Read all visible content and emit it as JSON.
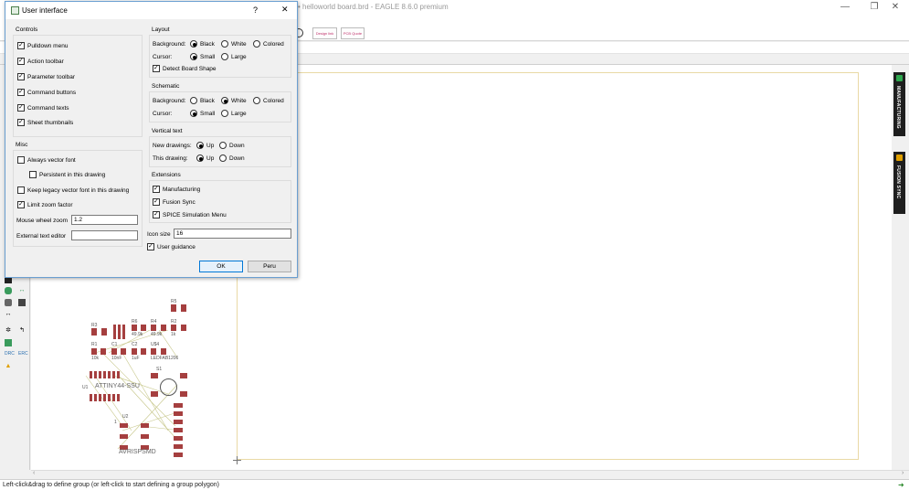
{
  "app": {
    "title": "• helloworld board.brd - EAGLE 8.6.0 premium",
    "min_glyph": "—",
    "max_glyph": "❐",
    "close_glyph": "✕"
  },
  "toolbar": {
    "btn1": "Design link",
    "btn2": "PCB Quote"
  },
  "canvas": {
    "parts": {
      "r1": "R1",
      "r1v": "10k",
      "c1": "C1",
      "c1v": "10nF",
      "c2": "C2",
      "c2v": "1uF",
      "r6": "R6",
      "r6v": "49.9k",
      "r4": "R4",
      "r4v": "49.9k",
      "r2": "R2",
      "r2v": "1k",
      "r3": "R3",
      "u1": "U1",
      "u1v": "ATTINY44-SSU",
      "led": "U$4",
      "ledv": "LEDFAB1206",
      "r5": "R5",
      "s1": "S1",
      "u2": "U2",
      "u2v": "AVRISPSMD",
      "pin1": "1"
    }
  },
  "right_panel": {
    "tab1": "MANUFACTURING",
    "tab2": "FUSION SYNC"
  },
  "status": {
    "text": "Left-click&drag to define group (or left-click to start defining a group polygon)",
    "icon": "➜"
  },
  "dialog": {
    "title": "User interface",
    "help": "?",
    "close": "✕",
    "controls": {
      "title": "Controls",
      "items": [
        "Pulldown menu",
        "Action toolbar",
        "Parameter toolbar",
        "Command buttons",
        "Command texts",
        "Sheet thumbnails"
      ]
    },
    "misc": {
      "title": "Misc",
      "always_vector": "Always vector font",
      "persistent": "Persistent in this drawing",
      "keep_legacy": "Keep legacy vector font in this drawing",
      "limit_zoom": "Limit zoom factor",
      "mouse_wheel_label": "Mouse wheel zoom",
      "mouse_wheel_value": "1.2",
      "ext_editor_label": "External text editor",
      "ext_editor_value": ""
    },
    "layout": {
      "title": "Layout",
      "background_label": "Background:",
      "bg_options": [
        "Black",
        "White",
        "Colored"
      ],
      "bg_selected": "Black",
      "cursor_label": "Cursor:",
      "cursor_options": [
        "Small",
        "Large"
      ],
      "cursor_selected": "Small",
      "detect_board": "Detect Board Shape"
    },
    "schematic": {
      "title": "Schematic",
      "background_label": "Background:",
      "bg_options": [
        "Black",
        "White",
        "Colored"
      ],
      "bg_selected": "White",
      "cursor_label": "Cursor:",
      "cursor_options": [
        "Small",
        "Large"
      ],
      "cursor_selected": "Small"
    },
    "vertical_text": {
      "title": "Vertical text",
      "new_label": "New drawings:",
      "this_label": "This drawing:",
      "options": [
        "Up",
        "Down"
      ],
      "new_selected": "Up",
      "this_selected": "Up"
    },
    "extensions": {
      "title": "Extensions",
      "items": [
        "Manufacturing",
        "Fusion Sync",
        "SPICE Simulation Menu"
      ]
    },
    "icon_size_label": "Icon size",
    "icon_size_value": "16",
    "user_guidance": "User guidance",
    "ok": "OK",
    "cancel": "Peru"
  }
}
